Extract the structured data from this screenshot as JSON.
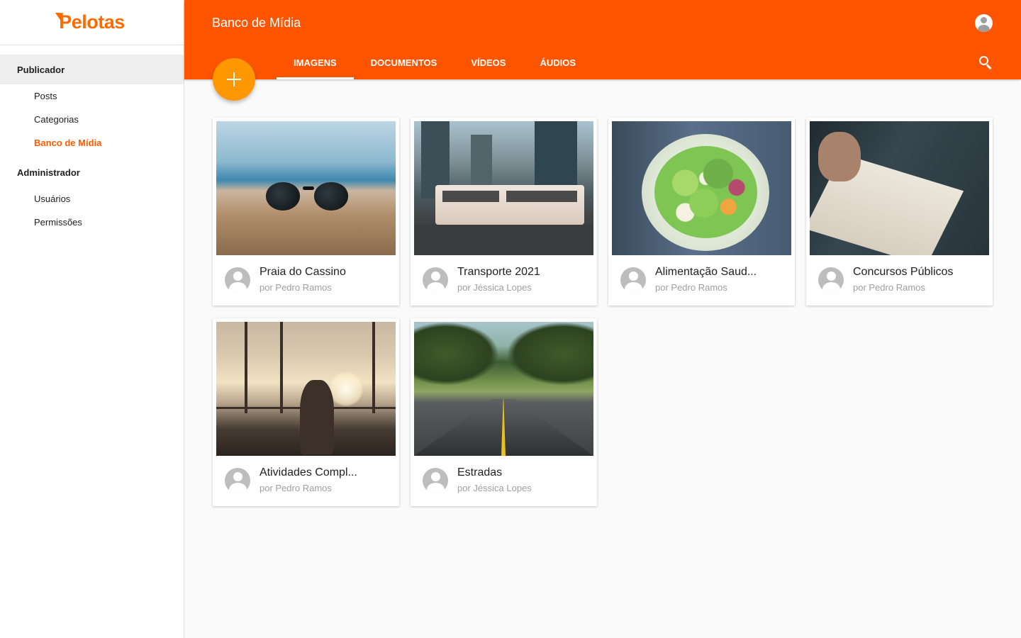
{
  "brand": {
    "name": "Pelotas",
    "color": "#ff5500",
    "fab_color": "#ff9800"
  },
  "sidebar": {
    "sections": [
      {
        "title": "Publicador",
        "items": [
          {
            "label": "Posts"
          },
          {
            "label": "Categorias"
          },
          {
            "label": "Banco de Mídia",
            "active": true
          }
        ]
      },
      {
        "title": "Administrador",
        "items": [
          {
            "label": "Usuários"
          },
          {
            "label": "Permissões"
          }
        ]
      }
    ]
  },
  "header": {
    "title": "Banco de Mídia",
    "tabs": [
      {
        "label": "IMAGENS"
      },
      {
        "label": "DOCUMENTOS"
      },
      {
        "label": "VÍDEOS"
      },
      {
        "label": "ÁUDIOS"
      }
    ],
    "active_tab": "IMAGENS",
    "fab_label": "+"
  },
  "media": [
    {
      "title": "Praia do Cassino",
      "author": "por Pedro Ramos",
      "image": "beach-sunglasses"
    },
    {
      "title": "Transporte 2021",
      "author": "por Jéssica Lopes",
      "image": "city-bus"
    },
    {
      "title": "Alimentação Saud...",
      "author": "por Pedro Ramos",
      "image": "salad-bowl"
    },
    {
      "title": "Concursos Públicos",
      "author": "por Pedro Ramos",
      "image": "notebook-writing"
    },
    {
      "title": "Atividades Compl...",
      "author": "por Pedro Ramos",
      "image": "outdoor-gym"
    },
    {
      "title": "Estradas",
      "author": "por Jéssica Lopes",
      "image": "tree-road"
    }
  ]
}
